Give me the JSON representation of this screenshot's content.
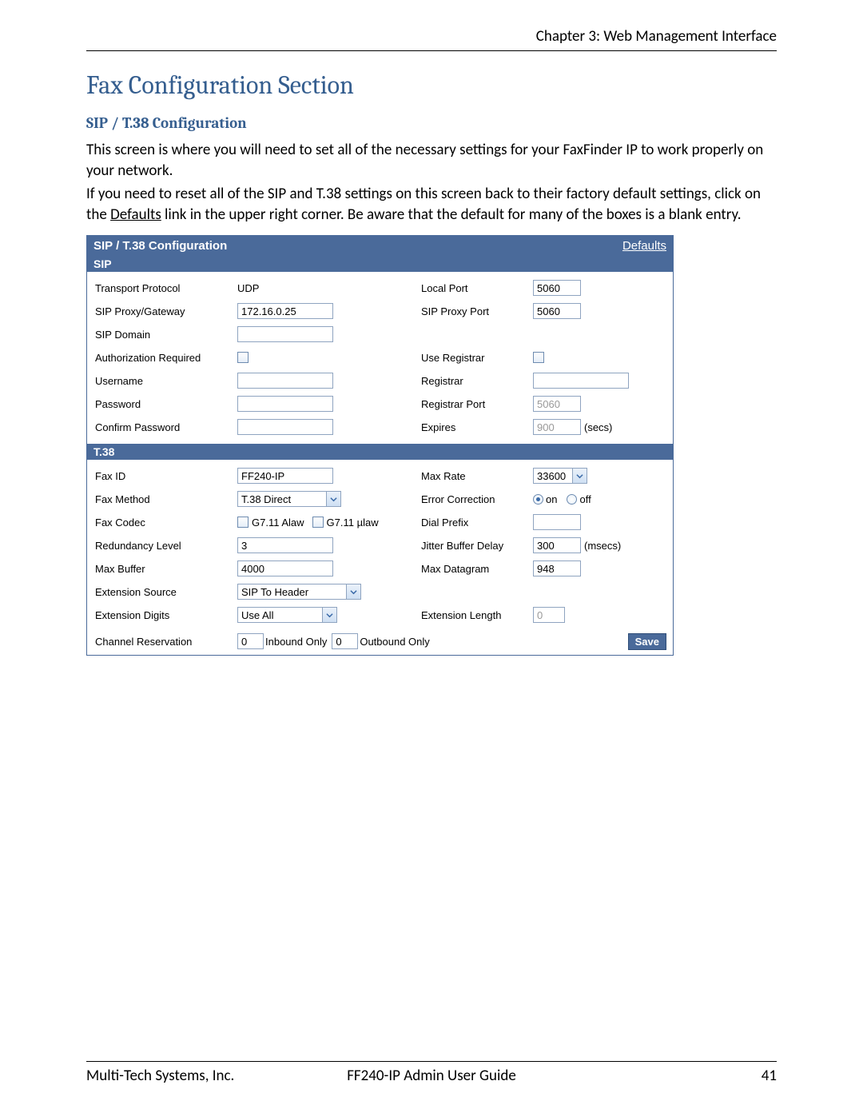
{
  "header": {
    "chapter": "Chapter 3: Web Management Interface"
  },
  "h1": "Fax Configuration Section",
  "h2": "SIP / T.38 Configuration",
  "para1": "This screen is where you will need to set all of the necessary settings for your FaxFinder IP to work properly on your network.",
  "para2a": "If you need to reset all of the SIP and T.38 settings on this screen back to their factory default settings, click on the ",
  "para2_link": "Defaults",
  "para2b": " link in the upper right corner. Be aware that the default for many of the boxes is a blank entry.",
  "panel": {
    "title": "SIP / T.38 Configuration",
    "defaults_link": "Defaults",
    "section_sip": "SIP",
    "section_t38": "T.38",
    "save": "Save"
  },
  "labels": {
    "transport_protocol": "Transport Protocol",
    "local_port": "Local Port",
    "sip_proxy": "SIP Proxy/Gateway",
    "sip_proxy_port": "SIP Proxy Port",
    "sip_domain": "SIP Domain",
    "auth_required": "Authorization Required",
    "use_registrar": "Use Registrar",
    "username": "Username",
    "registrar": "Registrar",
    "password": "Password",
    "registrar_port": "Registrar Port",
    "confirm_password": "Confirm Password",
    "expires": "Expires",
    "secs": "(secs)",
    "fax_id": "Fax ID",
    "max_rate": "Max Rate",
    "fax_method": "Fax Method",
    "error_correction": "Error Correction",
    "on": "on",
    "off": "off",
    "fax_codec": "Fax Codec",
    "g711_alaw": "G7.11 Alaw",
    "g711_ulaw": "G7.11 µlaw",
    "dial_prefix": "Dial Prefix",
    "redundancy": "Redundancy Level",
    "jitter": "Jitter Buffer Delay",
    "msecs": "(msecs)",
    "max_buffer": "Max Buffer",
    "max_datagram": "Max Datagram",
    "ext_source": "Extension Source",
    "ext_digits": "Extension Digits",
    "ext_length": "Extension Length",
    "channel_res": "Channel Reservation",
    "inbound_only": "Inbound Only",
    "outbound_only": "Outbound Only"
  },
  "values": {
    "transport_protocol": "UDP",
    "local_port": "5060",
    "sip_proxy": "172.16.0.25",
    "sip_proxy_port": "5060",
    "sip_domain": "",
    "username": "",
    "registrar": "",
    "password": "",
    "registrar_port": "5060",
    "confirm_password": "",
    "expires": "900",
    "fax_id": "FF240-IP",
    "max_rate": "33600",
    "fax_method": "T.38 Direct",
    "dial_prefix": "",
    "redundancy": "3",
    "jitter": "300",
    "max_buffer": "4000",
    "max_datagram": "948",
    "ext_source": "SIP To Header",
    "ext_digits": "Use All",
    "ext_length": "0",
    "ch_inbound": "0",
    "ch_outbound": "0"
  },
  "footer": {
    "left": "Multi-Tech Systems, Inc.",
    "mid": "FF240-IP Admin User Guide",
    "right": "41"
  }
}
